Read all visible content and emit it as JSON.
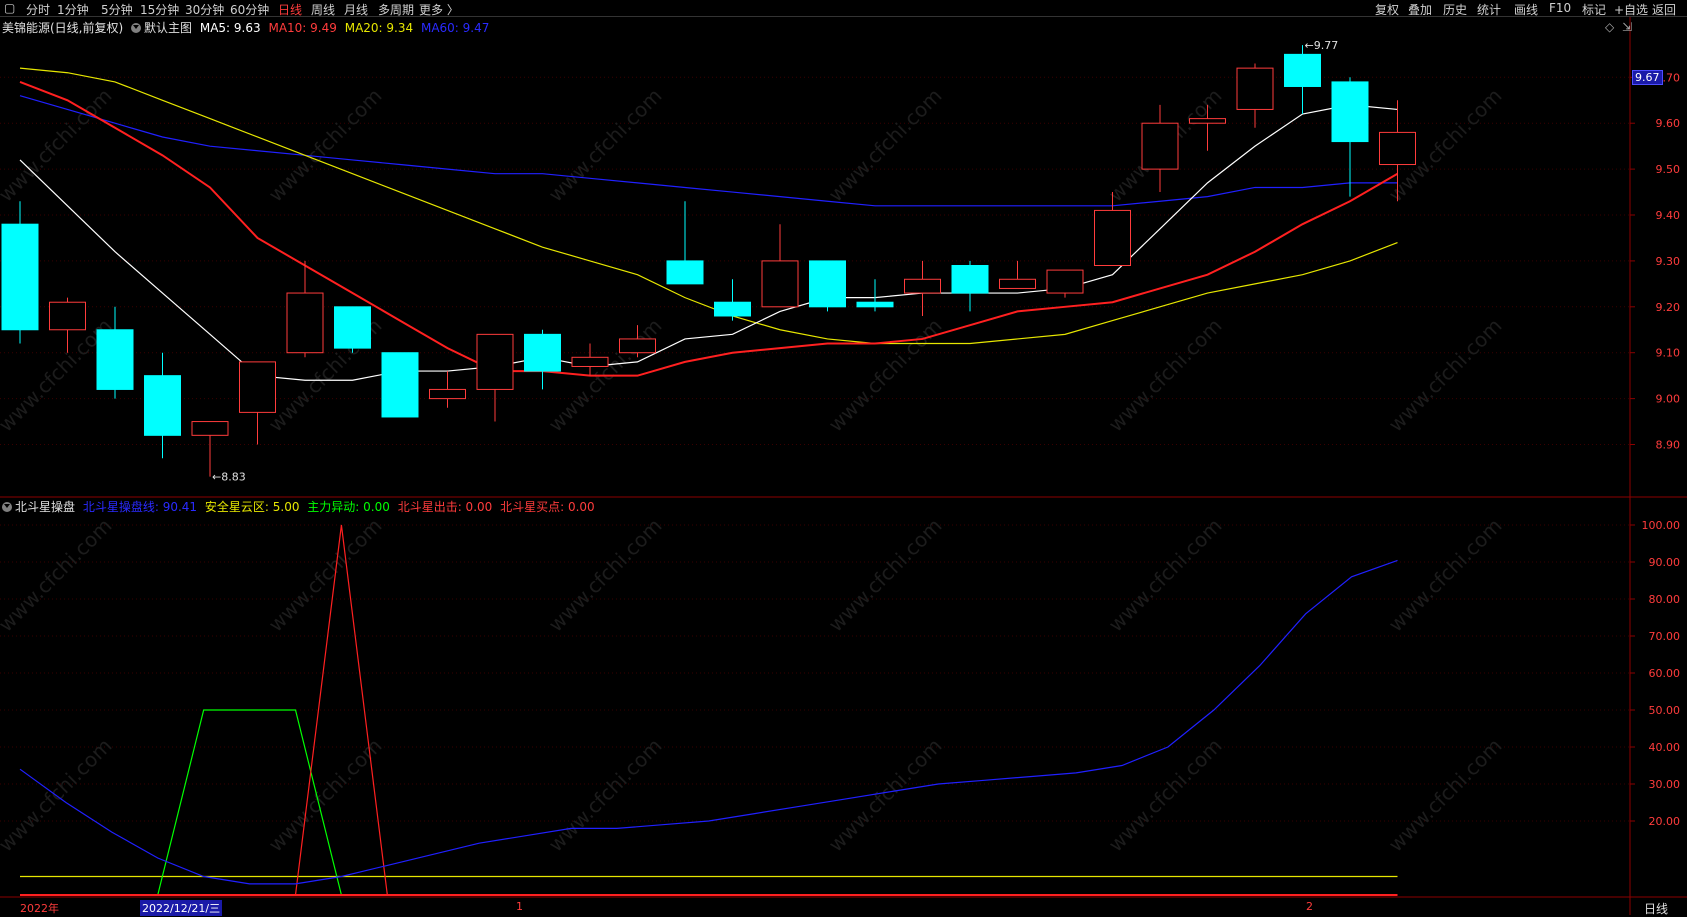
{
  "toolbar": {
    "left_items": [
      "分时",
      "1分钟",
      "5分钟",
      "15分钟",
      "30分钟",
      "60分钟",
      "日线",
      "周线",
      "月线",
      "多周期",
      "更多 〉"
    ],
    "active": "日线",
    "right_items": [
      "复权",
      "叠加",
      "历史",
      "统计",
      "画线",
      "F10",
      "标记",
      "+自选",
      "返回"
    ]
  },
  "main_legend": {
    "stock": "美锦能源(日线,前复权)",
    "template": "默认主图",
    "ma5": "MA5: 9.63",
    "ma10": "MA10: 9.49",
    "ma20": "MA20: 9.34",
    "ma60": "MA60: 9.47"
  },
  "sub_legend": {
    "name": "北斗星操盘",
    "curve": "北斗星操盘线: 90.41",
    "cloud": "安全星云区: 5.00",
    "force": "主力异动: 0.00",
    "out": "北斗星出击: 0.00",
    "buy": "北斗星买点: 0.00"
  },
  "price_axis": [
    "9.70",
    "9.60",
    "9.50",
    "9.40",
    "9.30",
    "9.20",
    "9.10",
    "9.00",
    "8.90"
  ],
  "current_price_badge": "9.67",
  "high_annotation": "9.77",
  "low_annotation": "8.83",
  "indicator_axis": [
    "100.00",
    "90.00",
    "80.00",
    "70.00",
    "60.00",
    "50.00",
    "40.00",
    "30.00",
    "20.00"
  ],
  "date_axis": {
    "year": "2022年",
    "cursor_date": "2022/12/21/三",
    "m1": "1",
    "m2": "2",
    "period": "日线"
  },
  "watermark": "www.cfchi.com",
  "colors": {
    "up": "#ff3c3c",
    "down": "#00ffff",
    "ma5": "#ffffff",
    "ma10": "#ff2020",
    "ma20": "#e6e600",
    "ma60": "#2020ff",
    "green": "#00ff00"
  },
  "chart_data": {
    "type": "candlestick",
    "price_range": [
      8.79,
      9.79
    ],
    "candles": [
      {
        "o": 9.38,
        "h": 9.43,
        "l": 9.12,
        "c": 9.15
      },
      {
        "o": 9.15,
        "h": 9.22,
        "l": 9.1,
        "c": 9.21
      },
      {
        "o": 9.15,
        "h": 9.2,
        "l": 9.0,
        "c": 9.02
      },
      {
        "o": 9.05,
        "h": 9.1,
        "l": 8.87,
        "c": 8.92
      },
      {
        "o": 8.92,
        "h": 8.95,
        "l": 8.83,
        "c": 8.95
      },
      {
        "o": 8.97,
        "h": 9.08,
        "l": 8.9,
        "c": 9.08
      },
      {
        "o": 9.1,
        "h": 9.3,
        "l": 9.09,
        "c": 9.23
      },
      {
        "o": 9.2,
        "h": 9.2,
        "l": 9.1,
        "c": 9.11
      },
      {
        "o": 9.1,
        "h": 9.1,
        "l": 8.96,
        "c": 8.96
      },
      {
        "o": 9.0,
        "h": 9.06,
        "l": 8.98,
        "c": 9.02
      },
      {
        "o": 9.02,
        "h": 9.14,
        "l": 8.95,
        "c": 9.14
      },
      {
        "o": 9.14,
        "h": 9.15,
        "l": 9.02,
        "c": 9.06
      },
      {
        "o": 9.07,
        "h": 9.12,
        "l": 9.05,
        "c": 9.09
      },
      {
        "o": 9.1,
        "h": 9.16,
        "l": 9.09,
        "c": 9.13
      },
      {
        "o": 9.3,
        "h": 9.43,
        "l": 9.25,
        "c": 9.25
      },
      {
        "o": 9.21,
        "h": 9.26,
        "l": 9.17,
        "c": 9.18
      },
      {
        "o": 9.2,
        "h": 9.38,
        "l": 9.2,
        "c": 9.3
      },
      {
        "o": 9.3,
        "h": 9.3,
        "l": 9.19,
        "c": 9.2
      },
      {
        "o": 9.21,
        "h": 9.26,
        "l": 9.19,
        "c": 9.2
      },
      {
        "o": 9.23,
        "h": 9.3,
        "l": 9.18,
        "c": 9.26
      },
      {
        "o": 9.29,
        "h": 9.3,
        "l": 9.19,
        "c": 9.23
      },
      {
        "o": 9.24,
        "h": 9.3,
        "l": 9.24,
        "c": 9.26
      },
      {
        "o": 9.23,
        "h": 9.28,
        "l": 9.22,
        "c": 9.28
      },
      {
        "o": 9.29,
        "h": 9.45,
        "l": 9.29,
        "c": 9.41
      },
      {
        "o": 9.5,
        "h": 9.64,
        "l": 9.45,
        "c": 9.6
      },
      {
        "o": 9.6,
        "h": 9.64,
        "l": 9.54,
        "c": 9.61
      },
      {
        "o": 9.63,
        "h": 9.73,
        "l": 9.59,
        "c": 9.72
      },
      {
        "o": 9.75,
        "h": 9.77,
        "l": 9.62,
        "c": 9.68
      },
      {
        "o": 9.69,
        "h": 9.7,
        "l": 9.44,
        "c": 9.56
      },
      {
        "o": 9.51,
        "h": 9.65,
        "l": 9.43,
        "c": 9.58
      }
    ],
    "ma5": [
      9.52,
      9.42,
      9.32,
      9.23,
      9.14,
      9.05,
      9.04,
      9.04,
      9.06,
      9.06,
      9.07,
      9.09,
      9.07,
      9.08,
      9.13,
      9.14,
      9.19,
      9.22,
      9.22,
      9.23,
      9.23,
      9.23,
      9.24,
      9.27,
      9.37,
      9.47,
      9.55,
      9.62,
      9.64,
      9.63
    ],
    "ma10": [
      9.69,
      9.65,
      9.59,
      9.53,
      9.46,
      9.35,
      9.29,
      9.23,
      9.17,
      9.11,
      9.06,
      9.06,
      9.05,
      9.05,
      9.08,
      9.1,
      9.11,
      9.12,
      9.12,
      9.13,
      9.16,
      9.19,
      9.2,
      9.21,
      9.24,
      9.27,
      9.32,
      9.38,
      9.43,
      9.49
    ],
    "ma20": [
      9.72,
      9.71,
      9.69,
      9.65,
      9.61,
      9.57,
      9.53,
      9.49,
      9.45,
      9.41,
      9.37,
      9.33,
      9.3,
      9.27,
      9.22,
      9.18,
      9.15,
      9.13,
      9.12,
      9.12,
      9.12,
      9.13,
      9.14,
      9.17,
      9.2,
      9.23,
      9.25,
      9.27,
      9.3,
      9.34
    ],
    "ma60": [
      9.66,
      9.63,
      9.6,
      9.57,
      9.55,
      9.54,
      9.53,
      9.52,
      9.51,
      9.5,
      9.49,
      9.49,
      9.48,
      9.47,
      9.46,
      9.45,
      9.44,
      9.43,
      9.42,
      9.42,
      9.42,
      9.42,
      9.42,
      9.42,
      9.43,
      9.44,
      9.46,
      9.46,
      9.47,
      9.47
    ],
    "indicator_range": [
      0,
      100
    ],
    "indicator": {
      "curve": [
        34,
        25,
        17,
        10,
        5,
        3,
        3,
        5,
        8,
        11,
        14,
        16,
        18,
        18,
        19,
        20,
        22,
        24,
        26,
        28,
        30,
        31,
        32,
        33,
        35,
        40,
        50,
        62,
        76,
        86,
        90.41
      ],
      "cloud": [
        0,
        0,
        0,
        0,
        50,
        50,
        50,
        0,
        0,
        0,
        0,
        0,
        0,
        0,
        0,
        0,
        0,
        0,
        0,
        0,
        0,
        0,
        0,
        0,
        0,
        0,
        0,
        0,
        0,
        0,
        0
      ],
      "force": [
        0,
        0,
        0,
        0,
        0,
        0,
        0,
        100,
        0,
        0,
        0,
        0,
        0,
        0,
        0,
        0,
        0,
        0,
        0,
        0,
        0,
        0,
        0,
        0,
        0,
        0,
        0,
        0,
        0,
        0,
        0
      ],
      "line_yellow": 5
    }
  }
}
